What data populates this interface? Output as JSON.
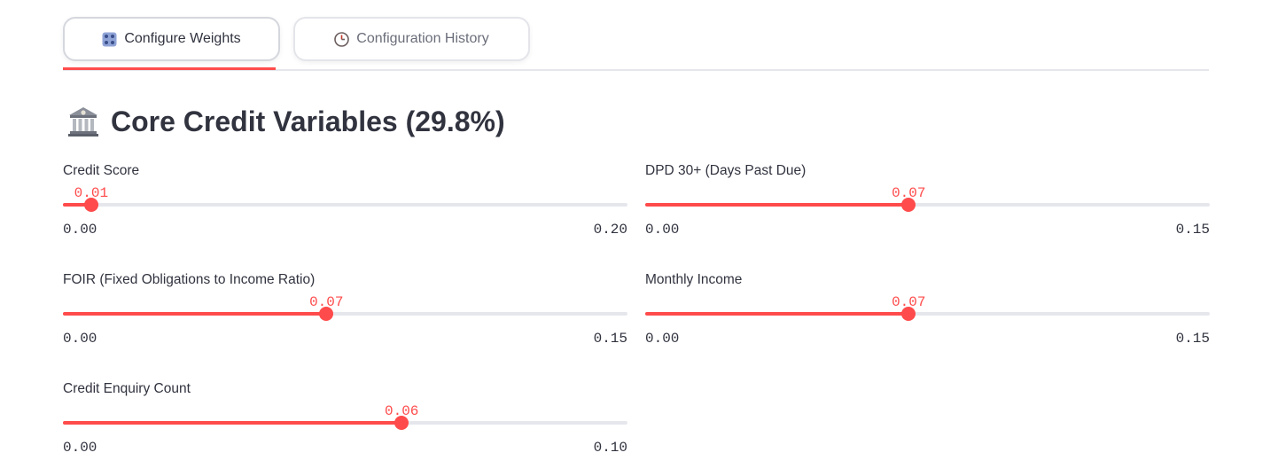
{
  "tabs": [
    {
      "label": "Configure Weights",
      "icon": "control-knobs-icon",
      "active": true
    },
    {
      "label": "Configuration History",
      "icon": "clock-icon",
      "active": false
    }
  ],
  "section": {
    "title": "Core Credit Variables (29.8%)",
    "icon": "bank-icon"
  },
  "sliders": [
    {
      "label": "Credit Score",
      "value": "0.01",
      "min": "0.00",
      "max": "0.20",
      "fraction": 0.05
    },
    {
      "label": "DPD 30+ (Days Past Due)",
      "value": "0.07",
      "min": "0.00",
      "max": "0.15",
      "fraction": 0.4667
    },
    {
      "label": "FOIR (Fixed Obligations to Income Ratio)",
      "value": "0.07",
      "min": "0.00",
      "max": "0.15",
      "fraction": 0.4667
    },
    {
      "label": "Monthly Income",
      "value": "0.07",
      "min": "0.00",
      "max": "0.15",
      "fraction": 0.4667
    },
    {
      "label": "Credit Enquiry Count",
      "value": "0.06",
      "min": "0.00",
      "max": "0.10",
      "fraction": 0.6
    }
  ],
  "colors": {
    "accent": "#ff4b4b",
    "track": "#e6e7ec",
    "text": "#31333f"
  }
}
